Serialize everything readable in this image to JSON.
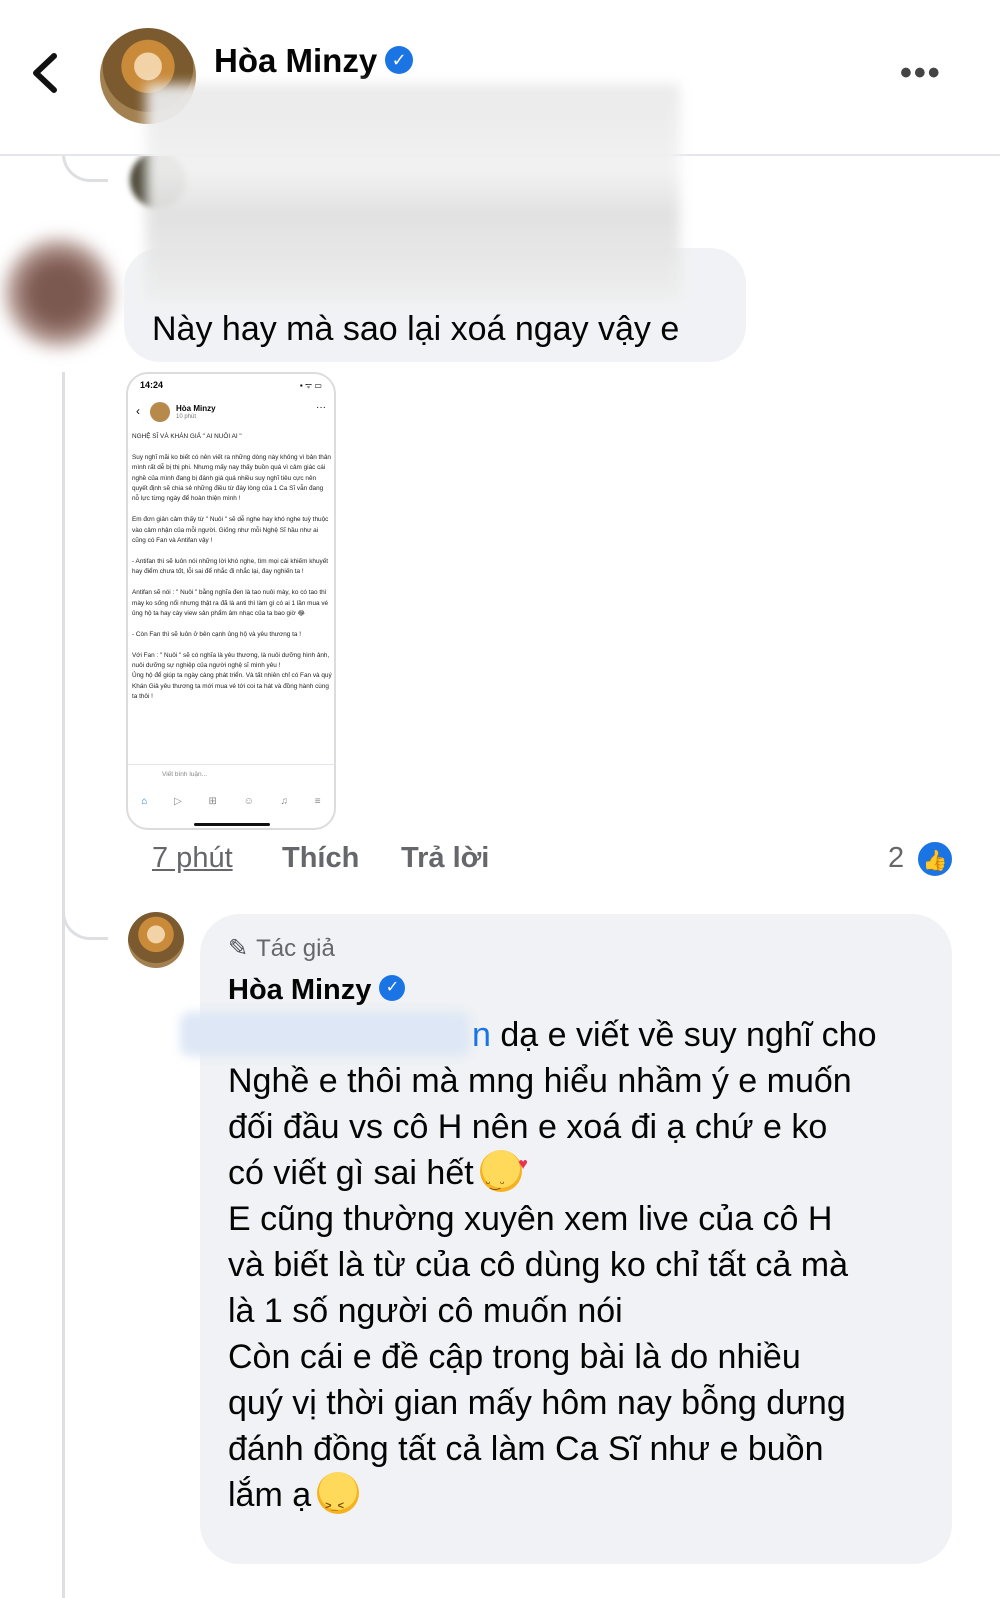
{
  "header": {
    "name": "Hòa Minzy",
    "verified_glyph": "✓",
    "more": "•••"
  },
  "comment": {
    "text": "Này hay mà sao lại xoá ngay vậy e",
    "screenshot": {
      "time": "14:24",
      "status": "▪ ᯤ ▭",
      "name": "Hòa Minzy",
      "sub": "10 phút",
      "body": "NGHỆ SĨ VÀ KHÁN GIẢ \" AI NUÔI AI \"\n\nSuy nghĩ mãi ko biết có nên viết ra những dòng này không vì bản thân mình rất dễ bị thị phi. Nhưng mấy nay thấy buồn quá vì cảm giác cái nghề của mình đang bị đánh giá quá nhiều suy nghĩ tiêu cực nên quyết định sẽ chia sẻ những điều từ đáy lòng của 1 Ca Sĩ vẫn đang nỗ lực từng ngày để hoàn thiện mình !\n\nEm đơn giản cảm thấy từ \" Nuôi \" sẽ dễ nghe hay khó nghe tuỳ thuộc vào cảm nhận của mỗi người. Giống như mỗi Nghệ Sĩ hầu như ai cũng có Fan và Antifan vậy !\n\n- Antifan thì sẽ luôn nói những lời khó nghe, tìm mọi cái khiếm khuyết hay điểm chưa tốt, lỗi sai để nhắc đi nhắc lại, đay nghiến ta !\n\nAntifan sẽ nói : \" Nuôi \" bằng nghĩa đen là tao nuôi mày, ko có tao thì mày ko sống nổi nhưng thật ra đã là anti thì làm gì có ai 1 lần mua vé ủng hộ ta hay cày view sản phẩm âm nhạc của ta bao giờ 😂\n\n- Còn Fan thì sẽ luôn ở bên cạnh ủng hộ và yêu thương ta !\n\nVới Fan : \" Nuôi \" sẽ có nghĩa là yêu thương, là nuôi dưỡng hình ảnh, nuôi dưỡng sự nghiệp của người nghệ sĩ mình yêu !\nỦng hộ để giúp ta ngày càng phát triển. Và tất nhiên chỉ có Fan và quý Khán Giả yêu thương ta mới mua vé tới coi ta hát và đồng hành cùng ta thôi !",
      "comment_placeholder": "Viết bình luận...",
      "nav": [
        "⌂",
        "▷",
        "⊞",
        "☺",
        "♫",
        "≡"
      ]
    },
    "time": "7 phút",
    "like": "Thích",
    "reply": "Trả lời",
    "reaction_count": "2",
    "like_glyph": "👍"
  },
  "reply": {
    "author_tag": "Tác giả",
    "pen_glyph": "✎",
    "name": "Hòa Minzy",
    "mention": "n",
    "text_1": " dạ e viết về suy nghĩ cho\nNghề e thôi mà mng hiểu nhầm ý e muốn\nđối đầu vs cô H nên e xoá đi ạ chứ e ko\ncó viết gì sai hết",
    "text_2": "\nE cũng thường xuyên xem live của cô H\nvà biết là từ của cô dùng ko chỉ tất cả mà\nlà 1 số người cô muốn nói\nCòn cái e đề cập trong bài là do nhiều\nquý vị thời gian mấy hôm nay bỗng dưng\nđánh đồng tất cả làm Ca Sĩ như e buồn\nlắm ạ"
  },
  "colors": {
    "accent": "#1b74e4",
    "bubble": "#f0f2f5",
    "meta": "#65676b"
  }
}
